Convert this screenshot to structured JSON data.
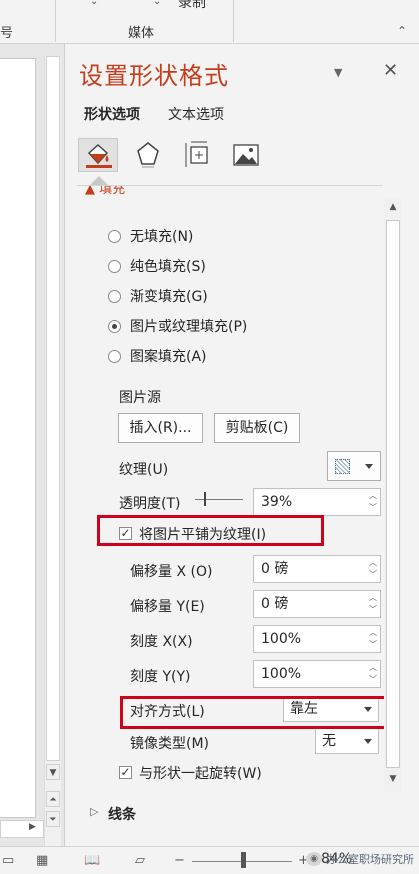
{
  "ribbon": {
    "left_partial_label": "号",
    "top_label_partial": "录制",
    "group_label": "媒体"
  },
  "panel": {
    "title": "设置形状格式",
    "tabs": [
      "形状选项",
      "文本选项"
    ],
    "icons": [
      "fill-line-icon",
      "effects-icon",
      "size-properties-icon",
      "picture-icon"
    ]
  },
  "fill": {
    "header": "填充",
    "options": [
      {
        "label": "无填充(N)",
        "selected": false
      },
      {
        "label": "纯色填充(S)",
        "selected": false
      },
      {
        "label": "渐变填充(G)",
        "selected": false
      },
      {
        "label": "图片或纹理填充(P)",
        "selected": true
      },
      {
        "label": "图案填充(A)",
        "selected": false
      }
    ],
    "picture_source_label": "图片源",
    "insert_button": "插入(R)...",
    "clipboard_button": "剪贴板(C)",
    "texture_label": "纹理(U)",
    "transparency_label": "透明度(T)",
    "transparency_value": "39%",
    "transparency_level": 0.39,
    "tile_checkbox_label": "将图片平铺为纹理(I)",
    "tile_checked": true,
    "offset_x_label": "偏移量 X (O)",
    "offset_x_value": "0 磅",
    "offset_y_label": "偏移量 Y(E)",
    "offset_y_value": "0 磅",
    "scale_x_label": "刻度 X(X)",
    "scale_x_value": "100%",
    "scale_y_label": "刻度 Y(Y)",
    "scale_y_value": "100%",
    "alignment_label": "对齐方式(L)",
    "alignment_value": "靠左",
    "mirror_label": "镜像类型(M)",
    "mirror_value": "无",
    "rotate_checkbox_label": "与形状一起旋转(W)",
    "rotate_checked": true
  },
  "line": {
    "header": "线条"
  },
  "status": {
    "zoom": "84%",
    "watermark": "办公室职场研究所"
  },
  "colors": {
    "accent": "#c43e1c",
    "highlight": "#d0021b"
  }
}
